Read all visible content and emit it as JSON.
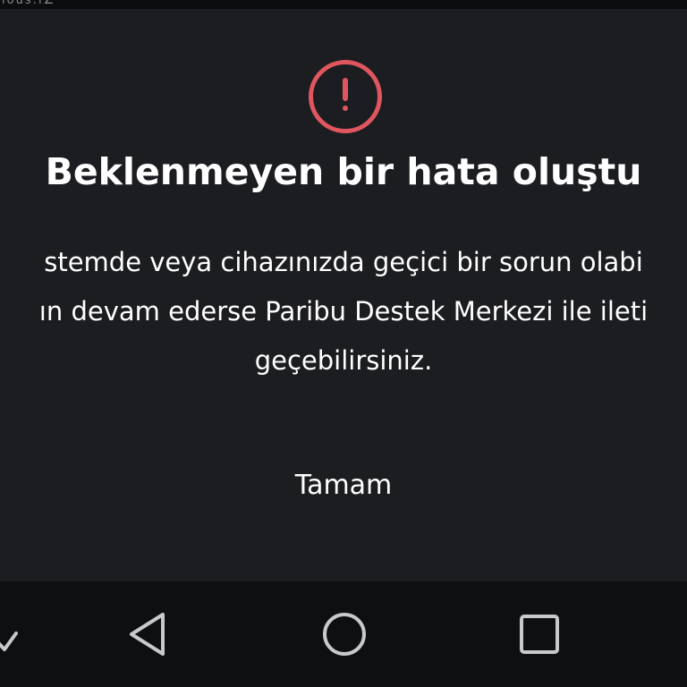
{
  "status_bar": {
    "fragment": "ıoǔs:ı∠"
  },
  "dialog": {
    "icon": "exclamation-circle-icon",
    "accent_color": "#e0565f",
    "title": "Beklenmeyen bir hata oluştu",
    "message_lines": [
      "stemde veya cihazınızda geçici bir sorun olabi",
      "ın devam ederse Paribu Destek Merkezi ile ileti",
      "geçebilirsiniz."
    ],
    "ok_label": "Tamam"
  },
  "nav_bar": {
    "buttons": [
      {
        "icon": "chevron-down-icon"
      },
      {
        "icon": "back-triangle-icon"
      },
      {
        "icon": "home-circle-icon"
      },
      {
        "icon": "recents-square-icon"
      }
    ]
  }
}
